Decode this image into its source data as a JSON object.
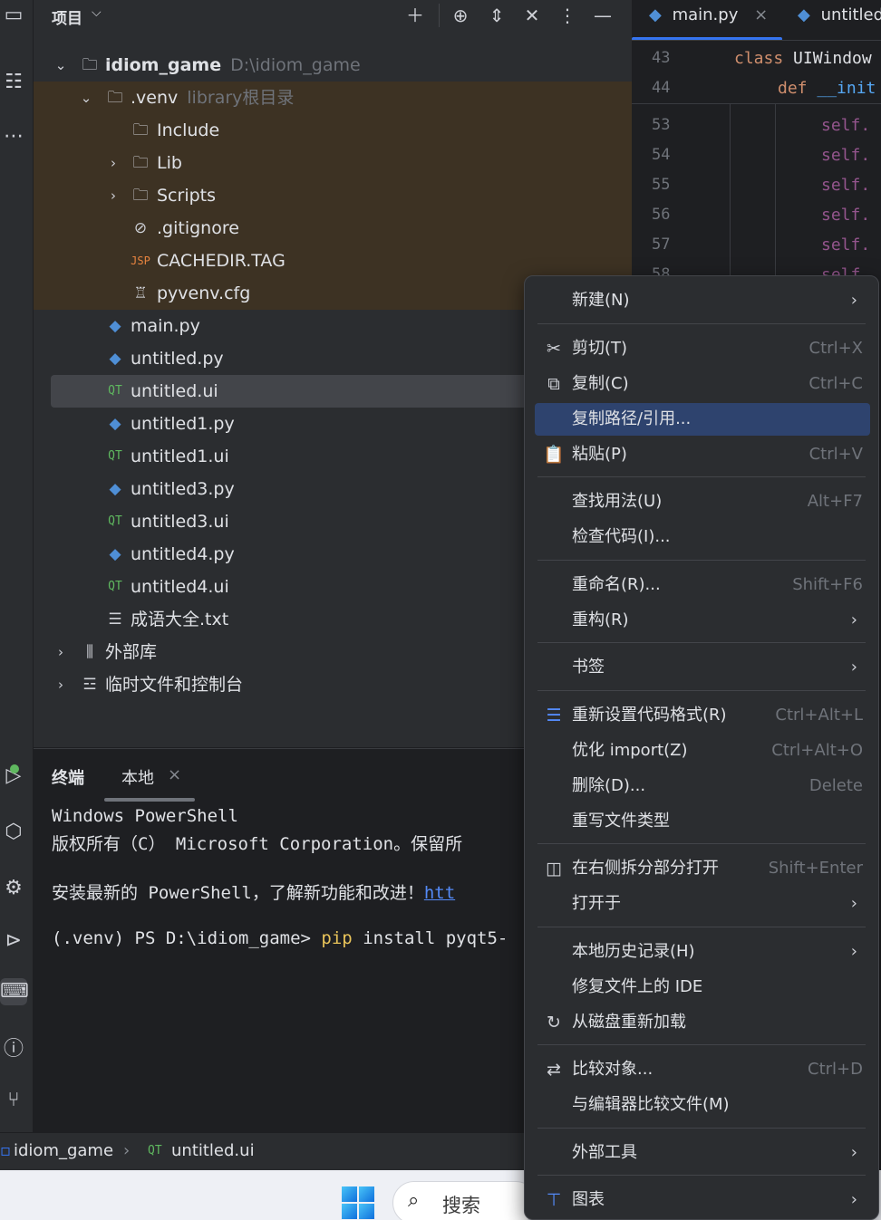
{
  "project_panel": {
    "title": "项目",
    "tree": [
      {
        "name": "idiom_game",
        "hint": "D:\\idiom_game"
      },
      {
        "name": ".venv",
        "hint": "library根目录"
      },
      {
        "name": "Include"
      },
      {
        "name": "Lib"
      },
      {
        "name": "Scripts"
      },
      {
        "name": ".gitignore"
      },
      {
        "name": "CACHEDIR.TAG"
      },
      {
        "name": "pyvenv.cfg"
      },
      {
        "name": "main.py"
      },
      {
        "name": "untitled.py"
      },
      {
        "name": "untitled.ui"
      },
      {
        "name": "untitled1.py"
      },
      {
        "name": "untitled1.ui"
      },
      {
        "name": "untitled3.py"
      },
      {
        "name": "untitled3.ui"
      },
      {
        "name": "untitled4.py"
      },
      {
        "name": "untitled4.ui"
      },
      {
        "name": "成语大全.txt"
      },
      {
        "name": "外部库"
      },
      {
        "name": "临时文件和控制台"
      }
    ]
  },
  "editor": {
    "tabs": [
      {
        "label": "main.py",
        "close": "×"
      },
      {
        "label": "untitled"
      }
    ],
    "line_numbers": [
      "43",
      "44",
      "53",
      "54",
      "55",
      "56",
      "57",
      "58"
    ],
    "code": {
      "l43_kw": "class",
      "l43_name": "UIWindow",
      "l44_kw": "def",
      "l44_name": "__init",
      "self_prefix": "self."
    }
  },
  "terminal": {
    "title": "终端",
    "tab": "本地",
    "tab_close": "×",
    "lines": [
      "Windows PowerShell",
      "版权所有（C） Microsoft Corporation。保留所",
      "安装最新的 PowerShell，了解新功能和改进！",
      "(.venv) PS D:\\idiom_game> "
    ],
    "link": "htt",
    "command": "pip",
    "args": " install pyqt5-"
  },
  "statusbar": {
    "crumbs": [
      "idiom_game",
      "untitled.ui"
    ],
    "sep": "›"
  },
  "taskbar": {
    "search": "搜索"
  },
  "context_menu": {
    "items": [
      {
        "label": "新建(N)",
        "shortcut": "",
        "submenu": true
      },
      {
        "label": "剪切(T)",
        "shortcut": "Ctrl+X"
      },
      {
        "label": "复制(C)",
        "shortcut": "Ctrl+C"
      },
      {
        "label": "复制路径/引用...",
        "shortcut": ""
      },
      {
        "label": "粘贴(P)",
        "shortcut": "Ctrl+V"
      },
      {
        "label": "查找用法(U)",
        "shortcut": "Alt+F7"
      },
      {
        "label": "检查代码(I)...",
        "shortcut": ""
      },
      {
        "label": "重命名(R)...",
        "shortcut": "Shift+F6"
      },
      {
        "label": "重构(R)",
        "shortcut": "",
        "submenu": true
      },
      {
        "label": "书签",
        "shortcut": "",
        "submenu": true
      },
      {
        "label": "重新设置代码格式(R)",
        "shortcut": "Ctrl+Alt+L"
      },
      {
        "label": "优化 import(Z)",
        "shortcut": "Ctrl+Alt+O"
      },
      {
        "label": "删除(D)...",
        "shortcut": "Delete"
      },
      {
        "label": "重写文件类型",
        "shortcut": ""
      },
      {
        "label": "在右侧拆分部分打开",
        "shortcut": "Shift+Enter"
      },
      {
        "label": "打开于",
        "shortcut": "",
        "submenu": true
      },
      {
        "label": "本地历史记录(H)",
        "shortcut": "",
        "submenu": true
      },
      {
        "label": "修复文件上的 IDE",
        "shortcut": ""
      },
      {
        "label": "从磁盘重新加载",
        "shortcut": ""
      },
      {
        "label": "比较对象...",
        "shortcut": "Ctrl+D"
      },
      {
        "label": "与编辑器比较文件(M)",
        "shortcut": ""
      },
      {
        "label": "外部工具",
        "shortcut": "",
        "submenu": true
      },
      {
        "label": "图表",
        "shortcut": "",
        "submenu": true
      }
    ],
    "submenu_arrow": "›"
  },
  "colors": {
    "background": "#1e1f22",
    "panel": "#2b2d30",
    "excluded_folder": "#3d3223",
    "selection": "#43454a",
    "menu_highlight": "#2e436e",
    "accent": "#3574f0",
    "python_icon": "#4f8fd6",
    "qt_icon": "#5fb85f",
    "keyword": "#cf8e6d",
    "self_keyword": "#94558d"
  },
  "icons": {
    "strip": [
      "folder-icon",
      "structure-icon",
      "more-icon",
      "run-icon",
      "python-packages-icon",
      "python-console-icon",
      "services-icon",
      "terminal-icon",
      "problems-icon",
      "git-icon"
    ],
    "header": [
      "add-icon",
      "locate-icon",
      "expand-icon",
      "collapse-icon",
      "more-icon",
      "minimize-icon"
    ]
  }
}
